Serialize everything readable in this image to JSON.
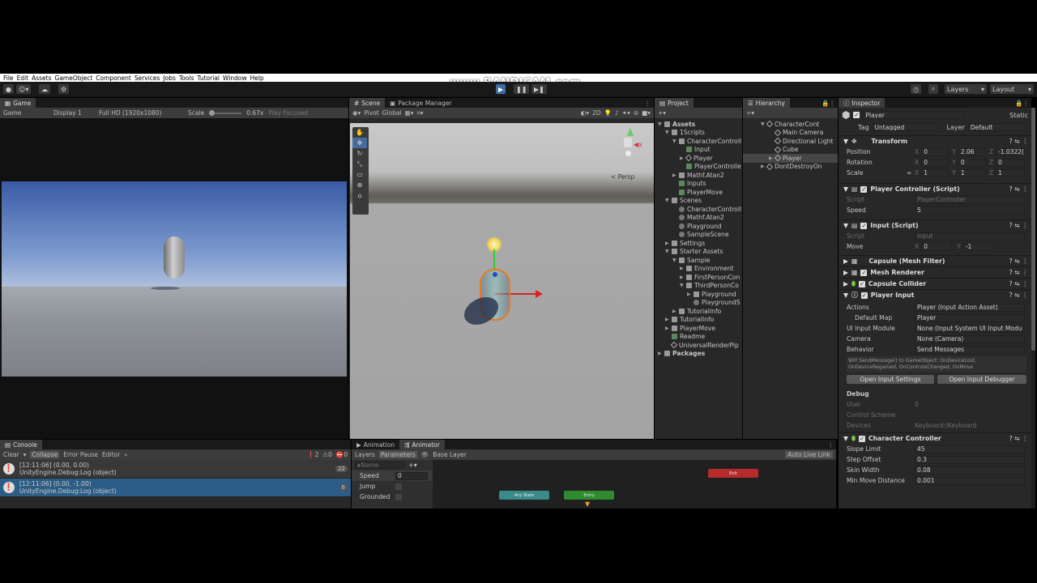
{
  "menu": [
    "File",
    "Edit",
    "Assets",
    "GameObject",
    "Component",
    "Services",
    "Jobs",
    "Tools",
    "Tutorial",
    "Window",
    "Help"
  ],
  "watermark": "www.BANDICAM.com",
  "toolbar": {
    "layers": "Layers",
    "layout": "Layout"
  },
  "game": {
    "tab": "Game",
    "mode": "Game",
    "display": "Display 1",
    "resolution": "Full HD (1920x1080)",
    "scale_label": "Scale",
    "scale_value": "0.67x",
    "play_focused": "Play Focused"
  },
  "scene": {
    "tabs": [
      "Scene",
      "Package Manager"
    ],
    "pivot": "Pivot",
    "global": "Global",
    "mode_2d": "2D",
    "persp": "< Persp"
  },
  "project": {
    "tab": "Project",
    "items": [
      {
        "label": "Assets",
        "depth": 0,
        "icon": "folder",
        "arrow": "▼",
        "bold": true
      },
      {
        "label": "1Scripts",
        "depth": 1,
        "icon": "folder",
        "arrow": "▼"
      },
      {
        "label": "CharacterControll",
        "depth": 2,
        "icon": "folder",
        "arrow": "▼"
      },
      {
        "label": "Input",
        "depth": 3,
        "icon": "cs",
        "arrow": ""
      },
      {
        "label": "Player",
        "depth": 3,
        "icon": "go",
        "arrow": "▶"
      },
      {
        "label": "PlayerControlle",
        "depth": 3,
        "icon": "cs",
        "arrow": ""
      },
      {
        "label": "Mathf.Atan2",
        "depth": 2,
        "icon": "folder",
        "arrow": "▶"
      },
      {
        "label": "Inputs",
        "depth": 2,
        "icon": "cs",
        "arrow": ""
      },
      {
        "label": "PlayerMove",
        "depth": 2,
        "icon": "cs",
        "arrow": ""
      },
      {
        "label": "Scenes",
        "depth": 1,
        "icon": "folder",
        "arrow": "▼"
      },
      {
        "label": "CharacterControll",
        "depth": 2,
        "icon": "scene",
        "arrow": ""
      },
      {
        "label": "Mathf.Atan2",
        "depth": 2,
        "icon": "scene",
        "arrow": ""
      },
      {
        "label": "Playground",
        "depth": 2,
        "icon": "scene",
        "arrow": ""
      },
      {
        "label": "SampleScene",
        "depth": 2,
        "icon": "scene",
        "arrow": ""
      },
      {
        "label": "Settings",
        "depth": 1,
        "icon": "folder",
        "arrow": "▶"
      },
      {
        "label": "Starter Assets",
        "depth": 1,
        "icon": "folder",
        "arrow": "▼"
      },
      {
        "label": "Sample",
        "depth": 2,
        "icon": "folder",
        "arrow": "▼"
      },
      {
        "label": "Environment",
        "depth": 3,
        "icon": "folder",
        "arrow": "▶"
      },
      {
        "label": "FirstPersonCon",
        "depth": 3,
        "icon": "folder",
        "arrow": "▶"
      },
      {
        "label": "ThirdPersonCo",
        "depth": 3,
        "icon": "folder",
        "arrow": "▼"
      },
      {
        "label": "Playground",
        "depth": 4,
        "icon": "folder",
        "arrow": "▶"
      },
      {
        "label": "PlaygroundS",
        "depth": 4,
        "icon": "scene",
        "arrow": ""
      },
      {
        "label": "TutorialInfo",
        "depth": 2,
        "icon": "folder",
        "arrow": "▶"
      },
      {
        "label": "TutorialInfo",
        "depth": 1,
        "icon": "folder",
        "arrow": "▶"
      },
      {
        "label": "PlayerMove",
        "depth": 1,
        "icon": "folder",
        "arrow": "▶"
      },
      {
        "label": "Readme",
        "depth": 1,
        "icon": "cs",
        "arrow": ""
      },
      {
        "label": "UniversalRenderPip",
        "depth": 1,
        "icon": "go",
        "arrow": ""
      },
      {
        "label": "Packages",
        "depth": 0,
        "icon": "folder",
        "arrow": "▶",
        "bold": true
      }
    ]
  },
  "hierarchy": {
    "tab": "Hierarchy",
    "items": [
      {
        "label": "CharacterCont",
        "depth": 0,
        "arrow": "▼",
        "selected": false
      },
      {
        "label": "Main Camera",
        "depth": 1,
        "arrow": "",
        "selected": false
      },
      {
        "label": "Directional Light",
        "depth": 1,
        "arrow": "",
        "selected": false
      },
      {
        "label": "Cube",
        "depth": 1,
        "arrow": "",
        "selected": false
      },
      {
        "label": "Player",
        "depth": 1,
        "arrow": "▶",
        "selected": true
      },
      {
        "label": "DontDestroyOn",
        "depth": 0,
        "arrow": "▶",
        "selected": false
      }
    ]
  },
  "inspector": {
    "tab": "Inspector",
    "object_name": "Player",
    "static": "Static",
    "tag_label": "Tag",
    "tag_value": "Untagged",
    "layer_label": "Layer",
    "layer_value": "Default",
    "transform": {
      "title": "Transform",
      "position": {
        "label": "Position",
        "x": "0",
        "y": "2.06",
        "z": "-1.0322("
      },
      "rotation": {
        "label": "Rotation",
        "x": "0",
        "y": "0",
        "z": "0"
      },
      "scale": {
        "label": "Scale",
        "x": "1",
        "y": "1",
        "z": "1"
      }
    },
    "player_controller": {
      "title": "Player Controller (Script)",
      "script_label": "Script",
      "script_value": "PlayerController",
      "speed_label": "Speed",
      "speed_value": "5"
    },
    "input_script": {
      "title": "Input (Script)",
      "script_label": "Script",
      "script_value": "Input",
      "move_label": "Move",
      "move_x": "0",
      "move_y": "-1"
    },
    "capsule_mesh_filter": "Capsule (Mesh Filter)",
    "mesh_renderer": "Mesh Renderer",
    "capsule_collider": "Capsule Collider",
    "player_input": {
      "title": "Player Input",
      "actions_label": "Actions",
      "actions_value": "Player (Input Action Asset)",
      "default_map_label": "Default Map",
      "default_map_value": "Player",
      "ui_module_label": "UI Input Module",
      "ui_module_value": "None (Input System UI Input Modu",
      "camera_label": "Camera",
      "camera_value": "None (Camera)",
      "behavior_label": "Behavior",
      "behavior_value": "Send Messages",
      "help_line1": "Will SendMessage() to GameObject: OnDeviceLost,",
      "help_line2": "OnDeviceRegained, OnControlsChanged, OnMove",
      "open_settings": "Open Input Settings",
      "open_debugger": "Open Input Debugger",
      "debug_label": "Debug",
      "user_label": "User",
      "user_value": "0",
      "scheme_label": "Control Scheme",
      "devices_label": "Devices",
      "devices_value": "Keyboard:/Keyboard"
    },
    "character_controller": {
      "title": "Character Controller",
      "slope_label": "Slope Limit",
      "slope_value": "45",
      "step_label": "Step Offset",
      "step_value": "0.3",
      "skin_label": "Skin Width",
      "skin_value": "0.08",
      "minmove_label": "Min Move Distance",
      "minmove_value": "0.001"
    }
  },
  "console": {
    "tab": "Console",
    "clear": "Clear",
    "collapse": "Collapse",
    "error_pause": "Error Pause",
    "editor": "Editor",
    "warn_count": "2",
    "err_count1": "0",
    "err_count2": "0",
    "entries": [
      {
        "line1": "[12:11:06] (0.00, 0.00)",
        "line2": "UnityEngine.Debug:Log (object)",
        "count": "22",
        "selected": false
      },
      {
        "line1": "[12:11:06] (0.00, -1.00)",
        "line2": "UnityEngine.Debug:Log (object)",
        "count": "6",
        "selected": true
      }
    ]
  },
  "animator": {
    "tabs": [
      "Animation",
      "Animator"
    ],
    "layers": "Layers",
    "parameters": "Parameters",
    "base_layer": "Base Layer",
    "auto_live": "Auto Live Link",
    "search_placeholder": "Name",
    "speed_label": "Speed",
    "speed_value": "0",
    "jump_label": "Jump",
    "grounded_label": "Grounded",
    "exit_node": "Exit",
    "any_state_node": "Any State",
    "entry_node": "Entry"
  }
}
